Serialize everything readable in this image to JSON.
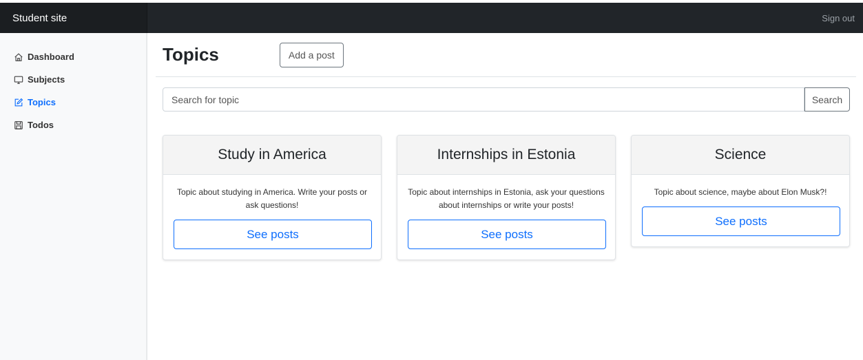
{
  "app": {
    "brand": "Student site",
    "sign_out": "Sign out"
  },
  "sidebar": {
    "items": [
      {
        "label": "Dashboard",
        "icon": "house-icon"
      },
      {
        "label": "Subjects",
        "icon": "monitor-icon"
      },
      {
        "label": "Topics",
        "icon": "pencil-square-icon",
        "active": true
      },
      {
        "label": "Todos",
        "icon": "save-icon"
      }
    ]
  },
  "main": {
    "title": "Topics",
    "add_post_label": "Add a post",
    "search": {
      "placeholder": "Search for topic",
      "button_label": "Search"
    },
    "cards": [
      {
        "title": "Study in America",
        "description": "Topic about studying in America. Write your posts or ask questions!",
        "button_label": "See posts"
      },
      {
        "title": "Internships in Estonia",
        "description": "Topic about internships in Estonia, ask your questions about internships or write your posts!",
        "button_label": "See posts"
      },
      {
        "title": "Science",
        "description": "Topic about science, maybe about Elon Musk?!",
        "button_label": "See posts"
      }
    ]
  },
  "colors": {
    "accent": "#0d6efd",
    "topbar": "#212529",
    "sidebar_bg": "#f8f9fa"
  }
}
